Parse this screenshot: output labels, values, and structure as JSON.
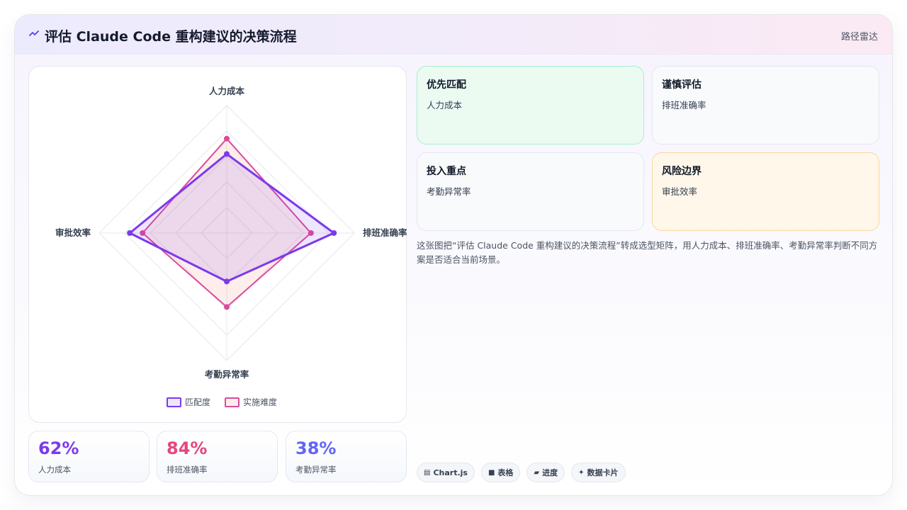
{
  "header": {
    "title": "评估 Claude Code 重构建议的决策流程",
    "right_label": "路径雷达",
    "title_icon": "trend-line-icon"
  },
  "chart_data": {
    "type": "radar",
    "title": "",
    "axes": [
      "人力成本",
      "排班准确率",
      "考勤异常率",
      "审批效率"
    ],
    "range": [
      0,
      100
    ],
    "grid": true,
    "legend_position": "bottom",
    "series": [
      {
        "name": "匹配度",
        "values": [
          62,
          84,
          38,
          76
        ],
        "color": "#7c3aed",
        "fill": "rgba(124,58,237,0.13)"
      },
      {
        "name": "实施难度",
        "values": [
          74,
          66,
          58,
          66
        ],
        "color": "#db4b9c",
        "fill": "rgba(240,150,130,0.16)"
      }
    ]
  },
  "stats": [
    {
      "value": "62%",
      "label": "人力成本",
      "color": "#7c3aed"
    },
    {
      "value": "84%",
      "label": "排班准确率",
      "color": "#e5467f"
    },
    {
      "value": "38%",
      "label": "考勤异常率",
      "color": "#6366f1"
    }
  ],
  "cards": [
    {
      "title": "优先匹配",
      "desc": "人力成本",
      "bg": "#ebfbf2",
      "border": "#a7f0c9"
    },
    {
      "title": "谨慎评估",
      "desc": "排班准确率",
      "bg": "#f8fafc",
      "border": "#e5e7eb"
    },
    {
      "title": "投入重点",
      "desc": "考勤异常率",
      "bg": "#f8fafc",
      "border": "#e5e7eb"
    },
    {
      "title": "风险边界",
      "desc": "审批效率",
      "bg": "#fff7ea",
      "border": "#fbd79c"
    }
  ],
  "note": "这张图把“评估 Claude Code 重构建议的决策流程”转成选型矩阵，用人力成本、排班准确率、考勤异常率判断不同方案是否适合当前场景。",
  "tags": [
    {
      "icon": "chart-icon",
      "glyph": "▤",
      "label": "Chart.js"
    },
    {
      "icon": "table-icon",
      "glyph": "■",
      "label": "表格"
    },
    {
      "icon": "progress-icon",
      "glyph": "▰",
      "label": "进度"
    },
    {
      "icon": "sparkle-icon",
      "glyph": "✦",
      "label": "数据卡片"
    }
  ]
}
